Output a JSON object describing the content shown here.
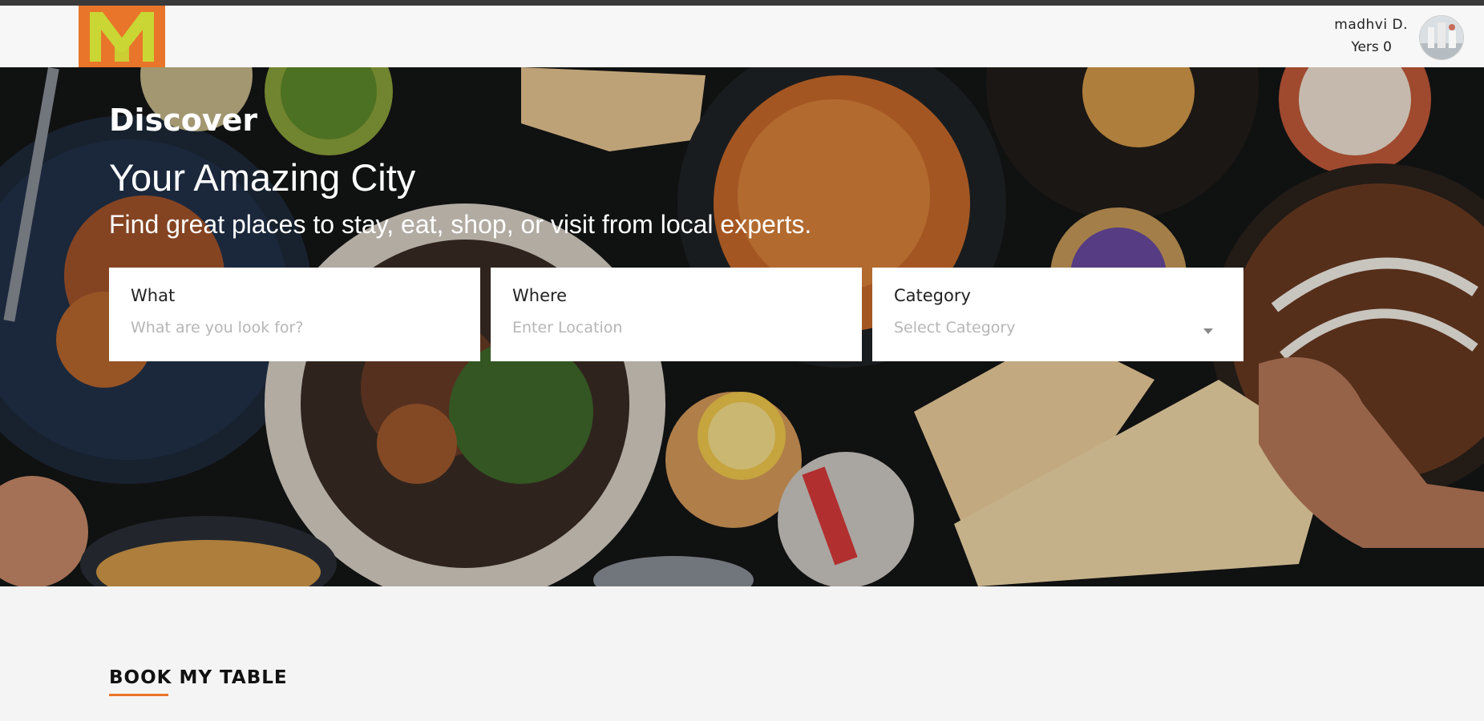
{
  "header": {
    "logo_letter": "M",
    "user_name": "madhvi D.",
    "user_meta": "Yers 0"
  },
  "hero": {
    "title": "Discover",
    "subtitle": "Your Amazing City",
    "tagline": "Find great places to stay, eat, shop, or visit from local experts."
  },
  "search": {
    "what_label": "What",
    "what_placeholder": "What are you look for?",
    "where_label": "Where",
    "where_placeholder": "Enter Location",
    "category_label": "Category",
    "category_selected": "Select Category"
  },
  "section": {
    "title": "BOOK MY TABLE"
  },
  "colors": {
    "accent": "#e8752a",
    "logo_green": "#c9d634"
  }
}
